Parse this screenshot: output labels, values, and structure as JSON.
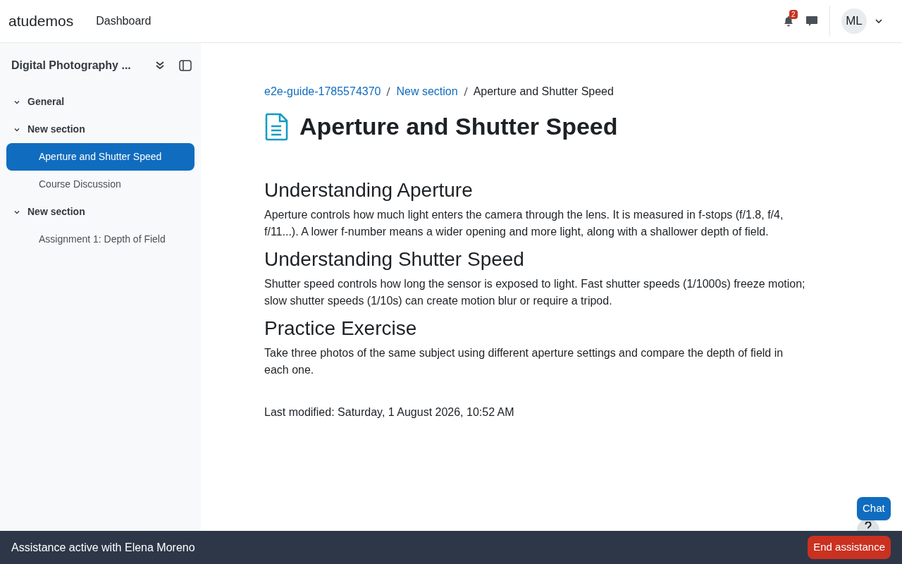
{
  "navbar": {
    "brand": "atudemos",
    "links": [
      "Dashboard"
    ],
    "notification_count": "2",
    "avatar_initials": "ML"
  },
  "sidebar": {
    "course_title": "Digital Photography ...",
    "sections": [
      {
        "title": "General",
        "expanded": true
      },
      {
        "title": "New section",
        "expanded": true,
        "children": [
          {
            "label": "Aperture and Shutter Speed",
            "selected": true
          },
          {
            "label": "Course Discussion",
            "selected": false
          }
        ]
      },
      {
        "title": "New section",
        "expanded": true,
        "children": [
          {
            "label": "Assignment 1: Depth of Field",
            "selected": false
          }
        ]
      }
    ]
  },
  "breadcrumb": [
    {
      "label": "e2e-guide-1785574370",
      "link": true
    },
    {
      "label": "New section",
      "link": true
    },
    {
      "label": "Aperture and Shutter Speed",
      "link": false
    }
  ],
  "page_title": "Aperture and Shutter Speed",
  "content": [
    {
      "kind": "heading",
      "text": "Understanding Aperture"
    },
    {
      "kind": "paragraph",
      "text": "Aperture controls how much light enters the camera through the lens. It is measured in f-stops (f/1.8, f/4, f/11...). A lower f-number means a wider opening and more light, along with a shallower depth of field."
    },
    {
      "kind": "heading",
      "text": "Understanding Shutter Speed"
    },
    {
      "kind": "paragraph",
      "text": "Shutter speed controls how long the sensor is exposed to light. Fast shutter speeds (1/1000s) freeze motion; slow shutter speeds (1/10s) can create motion blur or require a tripod."
    },
    {
      "kind": "heading",
      "text": "Practice Exercise"
    },
    {
      "kind": "paragraph",
      "text": "Take three photos of the same subject using different aperture settings and compare the depth of field in each one."
    }
  ],
  "last_modified": "Last modified: Saturday, 1 August 2026, 10:52 AM",
  "chat_button": "Chat",
  "footer": {
    "message": "Assistance active with Elena Moreno",
    "button": "End assistance"
  }
}
